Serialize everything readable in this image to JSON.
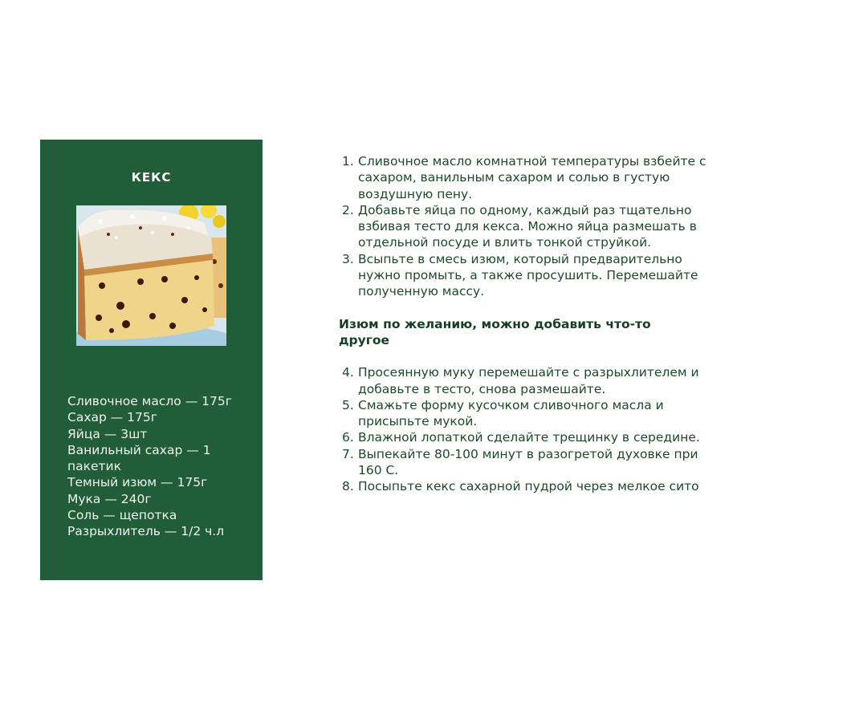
{
  "card": {
    "title": "КЕКС",
    "ingredients": [
      "Сливочное масло — 175г",
      "Сахар — 175г",
      "Яйца — 3шт",
      "Ванильный сахар — 1 пакетик",
      "Темный изюм — 175г",
      "Мука — 240г",
      "Соль — щепотка",
      "Разрыхлитель — 1/2 ч.л"
    ]
  },
  "steps_part1": [
    {
      "num": "1.",
      "text": "Сливочное масло комнатной температуры взбейте с сахаром, ванильным сахаром и солью в густую воздушную пену."
    },
    {
      "num": "2.",
      "text": "Добавьте яйца по одному, каждый раз тщательно взбивая тесто для кекса. Можно яйца размешать в отдельной посуде и влить тонкой струйкой."
    },
    {
      "num": "3.",
      "text": "Всыпьте в смесь изюм, который предварительно нужно промыть, а также просушить. Перемешайте полученную массу."
    }
  ],
  "note": "Изюм по желанию, можно добавить что-то другое",
  "steps_part2": [
    {
      "num": "4.",
      "text": "Просеянную муку перемешайте с разрыхлителем и добавьте в тесто, снова размешайте."
    },
    {
      "num": "5.",
      "text": "Смажьте форму кусочком сливочного масла и присыпьте мукой."
    },
    {
      "num": "6.",
      "text": "Влажной лопаткой сделайте трещинку в середине."
    },
    {
      "num": "7.",
      "text": "Выпекайте 80-100 минут в разогретой духовке при 160 С."
    },
    {
      "num": "8.",
      "text": "Посыпьте кекс сахарной пудрой через мелкое сито"
    }
  ],
  "colors": {
    "card_background": "#215d38",
    "text_dark_green": "#1e4a2b",
    "note_green": "#163f23"
  }
}
